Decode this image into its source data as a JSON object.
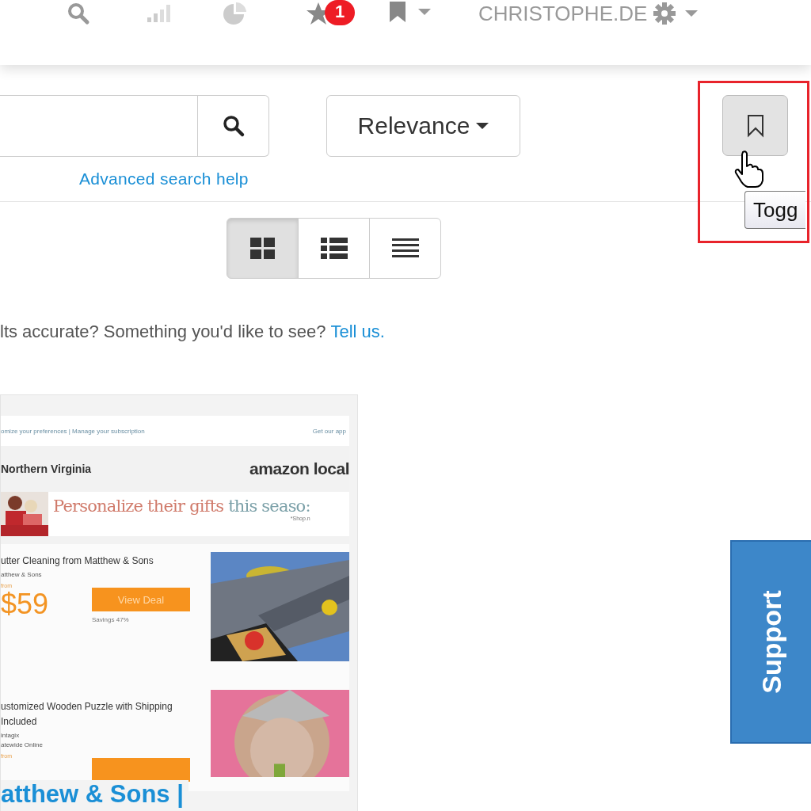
{
  "topbar": {
    "notification_count": "1",
    "user": "CHRISTOPHE.DE"
  },
  "search": {
    "sort_button": "Relevance",
    "advanced_link": "Advanced search help"
  },
  "tooltip": "Togg",
  "view_modes": [
    {
      "kind": "grid",
      "selected": true
    },
    {
      "kind": "list",
      "selected": false
    },
    {
      "kind": "compact",
      "selected": false
    }
  ],
  "feedback": {
    "text": "lts accurate? Something you'd like to see?",
    "link": "Tell us."
  },
  "result": {
    "email": {
      "header_links": "omize your preferences | Manage your subscription",
      "app_link": "Get our app",
      "region": "Northern Virginia",
      "brand": "amazon local",
      "banner": "Personalize their gifts",
      "banner_tail": "this seaso:",
      "banner_note": "*Shop.n",
      "deals": [
        {
          "title": "utter Cleaning from Matthew & Sons",
          "merchant": "atthew & Sons",
          "price_label": "from",
          "price": "$59",
          "button": "View Deal",
          "savings": "Savings 47%"
        },
        {
          "title": "ustomized Wooden Puzzle with Shipping Included",
          "merchant": "intagix",
          "location": "atewide Online",
          "price_label": "from"
        }
      ]
    },
    "title": "atthew & Sons |"
  },
  "support_tab": "Support"
}
